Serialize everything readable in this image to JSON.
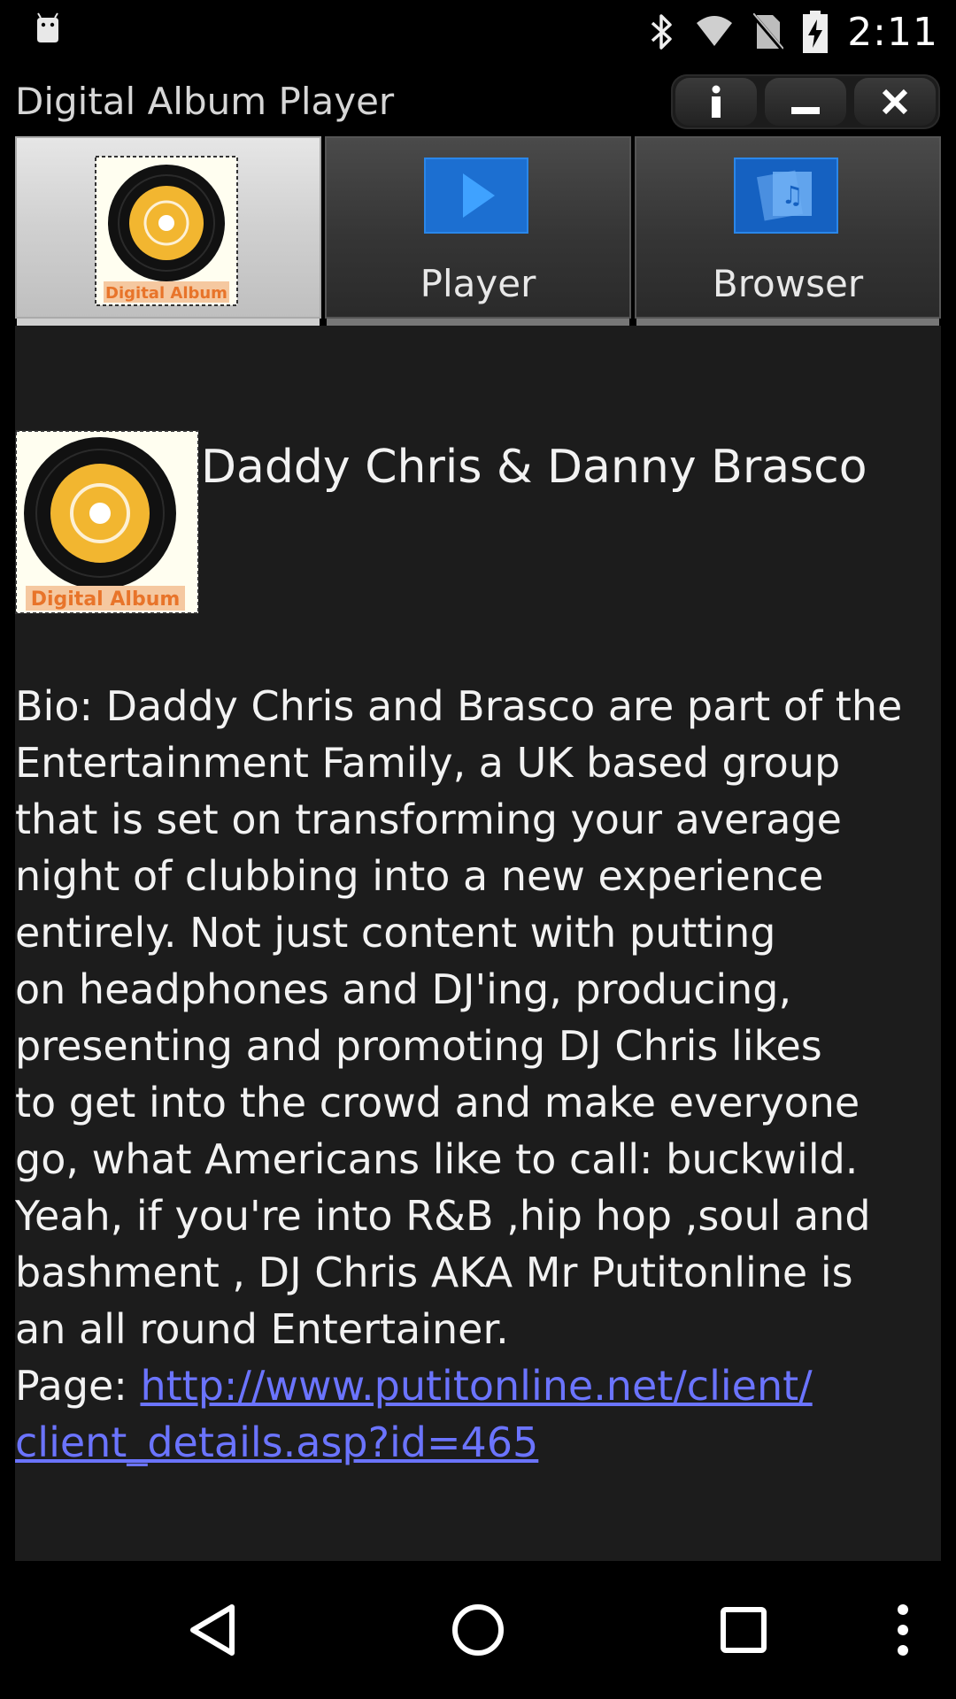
{
  "status_bar": {
    "time": "2:11",
    "icons": [
      "android-icon",
      "bluetooth-icon",
      "wifi-icon",
      "no-sim-icon",
      "battery-charging-icon"
    ]
  },
  "title_bar": {
    "title": "Digital Album Player",
    "buttons": [
      "info-icon",
      "minimize-icon",
      "close-icon"
    ]
  },
  "tabs": [
    {
      "label": "",
      "icon": "album-icon",
      "active": true
    },
    {
      "label": "Player",
      "icon": "play-icon",
      "active": false
    },
    {
      "label": "Browser",
      "icon": "browser-icon",
      "active": false
    }
  ],
  "album_logo_text": "Digital Album",
  "artist": {
    "name": "Daddy Chris & Danny Brasco"
  },
  "bio": {
    "lines": [
      "Bio: Daddy Chris and Brasco are  part of the",
      "Entertainment Family, a UK based group",
      "that is set on transforming your average",
      "night of clubbing into a new experience",
      "entirely. Not just content with putting",
      "on headphones and DJ'ing, producing,",
      "presenting and promoting DJ Chris likes",
      "to get into the crowd and make everyone",
      "go, what Americans like to call: buckwild.",
      "Yeah, if you're into R&B ,hip hop ,soul and",
      "bashment , DJ Chris AKA Mr Putitonline is",
      "an all round Entertainer."
    ],
    "page_label": "Page: ",
    "link_line1": "http://www.putitonline.net/client/",
    "link_line2": "client_details.asp?id=465"
  },
  "nav_bar": [
    "back-icon",
    "home-icon",
    "recents-icon",
    "overflow-menu-icon"
  ],
  "colors": {
    "link": "#6b74ff",
    "content_bg": "#1c1c1c",
    "album_yellow": "#f2b630"
  }
}
